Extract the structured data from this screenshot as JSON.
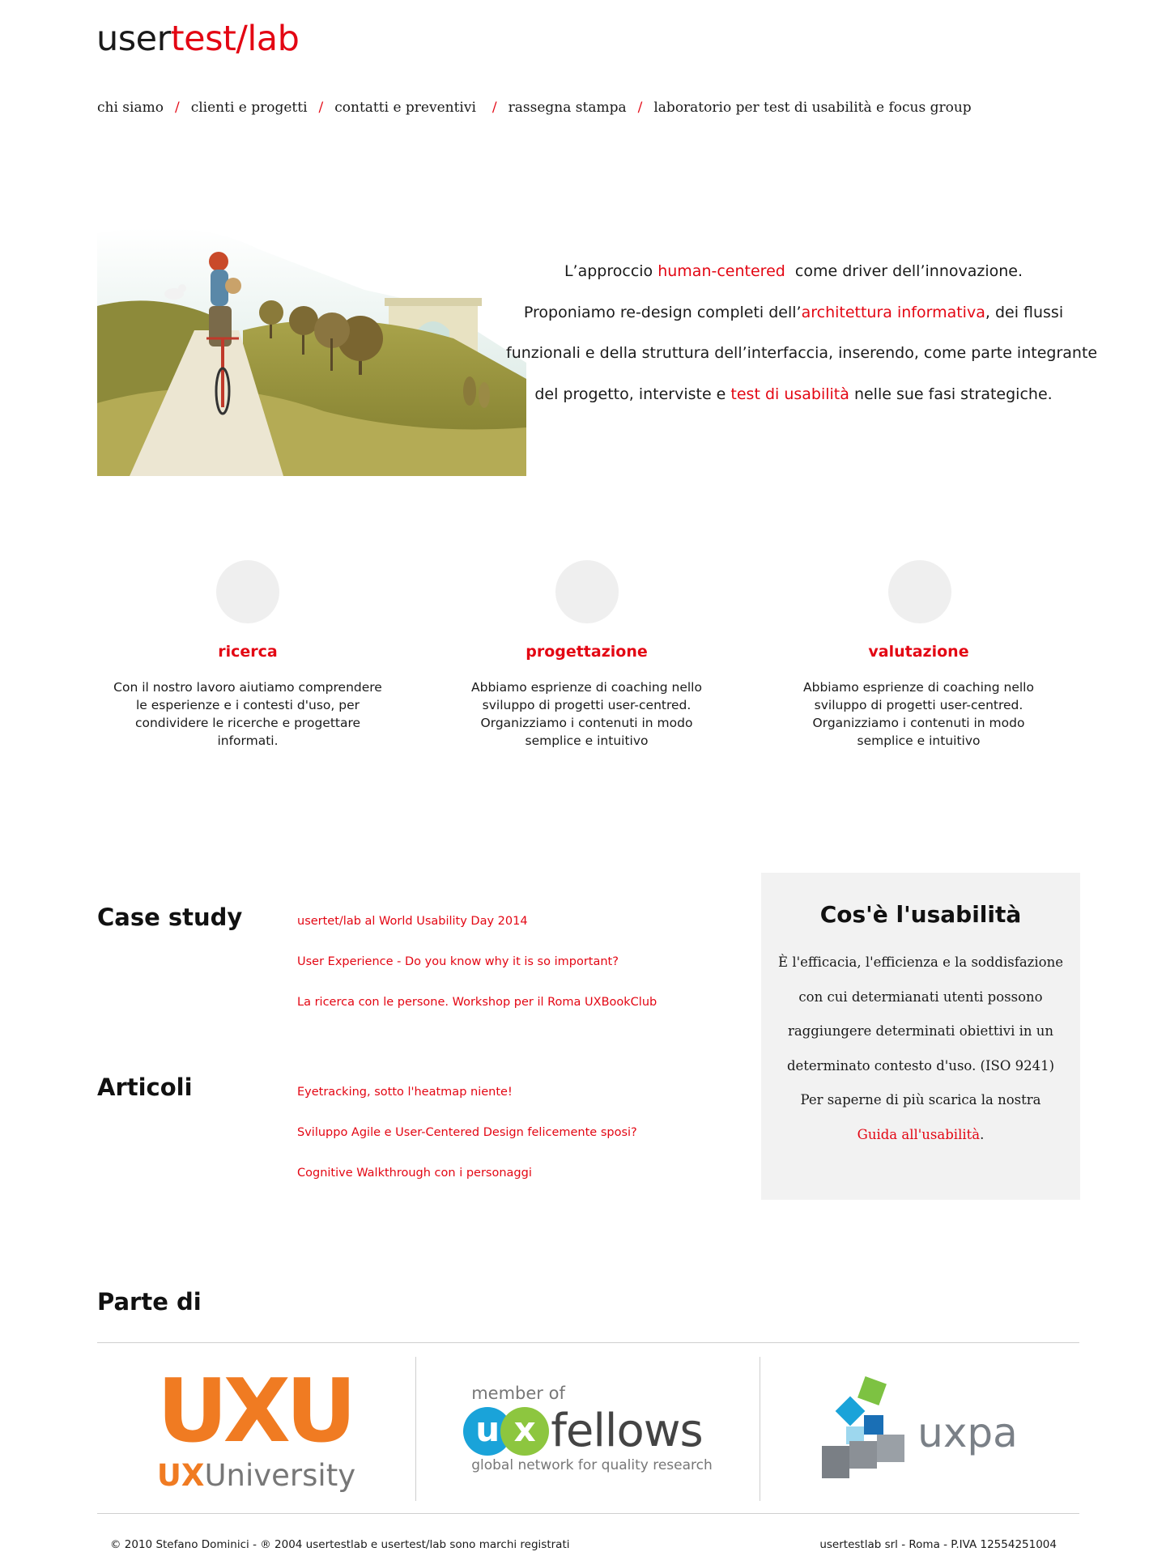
{
  "logo": {
    "part1": "user",
    "part2": "test",
    "part3": "/lab"
  },
  "nav": {
    "items": [
      "chi siamo",
      "clienti e progetti",
      "contatti e preventivi",
      "rassegna stampa",
      "laboratorio per test di usabilità e focus group"
    ],
    "separator": "/"
  },
  "hero": {
    "line1_a": "L’approccio ",
    "line1_link": "human-centered",
    "line1_b": "  come driver dell’innovazione.",
    "line2_a": "Proponiamo re-design completi dell’",
    "line2_link": "architettura informativa",
    "line2_b": ", dei flussi",
    "line3": "funzionali e della struttura dell’interfaccia, inserendo, come parte integrante",
    "line4_a": "del progetto, interviste e ",
    "line4_link": "test di usabilità",
    "line4_b": " nelle sue fasi strategiche."
  },
  "features": [
    {
      "title": "ricerca",
      "text": "Con il nostro lavoro aiutiamo comprendere le esperienze e i contesti d'uso, per condividere le ricerche e progettare informati."
    },
    {
      "title": "progettazione",
      "text": "Abbiamo esprienze di coaching nello sviluppo di progetti user-centred. Organizziamo i contenuti in modo semplice e intuitivo"
    },
    {
      "title": "valutazione",
      "text": "Abbiamo esprienze di coaching nello sviluppo di progetti user-centred. Organizziamo i contenuti in modo semplice e intuitivo"
    }
  ],
  "case_study": {
    "title": "Case study",
    "links": [
      "usertet/lab al World Usability Day 2014",
      "User Experience - Do you know why it is so important?",
      "La ricerca con le persone. Workshop per il Roma UXBookClub"
    ]
  },
  "articoli": {
    "title": "Articoli",
    "links": [
      "Eyetracking, sotto l'heatmap niente!",
      "Sviluppo Agile e User-Centered Design felicemente sposi?",
      "Cognitive Walkthrough con i personaggi"
    ]
  },
  "usability": {
    "title": "Cos'è l'usabilità",
    "lines": [
      "È l'efficacia, l'efficienza e la soddisfazione",
      "con cui determianati utenti possono",
      "raggiungere determinati obiettivi in un",
      "determinato contesto d'uso. (ISO 9241)",
      "Per saperne di più scarica la nostra"
    ],
    "link": "Guida all'usabilità",
    "link_suffix": "."
  },
  "parte_di": {
    "title": "Parte di",
    "uxu": {
      "mark": "UXU",
      "ux": "UX",
      "university": "University",
      "color": "#f07b22"
    },
    "uxfellows": {
      "member": "member of",
      "u": "u",
      "x": "x",
      "fellows": "fellows",
      "tagline": "global network for quality research"
    },
    "uxpa": {
      "name": "uxpa"
    }
  },
  "footer": {
    "left": "© 2010 Stefano Dominici - ® 2004 usertestlab e usertest/lab sono marchi registrati",
    "right": "usertestlab srl - Roma - P.IVA 12554251004"
  },
  "colors": {
    "accent": "#e30613",
    "box_bg": "#f2f2f2",
    "circle": "#efefef"
  }
}
